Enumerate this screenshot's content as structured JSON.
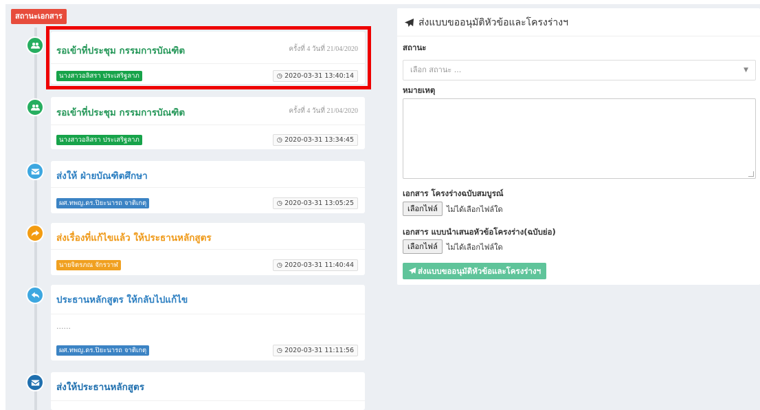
{
  "status_section": {
    "label": "สถานะเอกสาร"
  },
  "colors": {
    "green": "#27ae60",
    "sky": "#3da7e0",
    "orange": "#f39c12",
    "blue": "#1f6fae",
    "badge_green": "#17a34a",
    "badge_blue": "#3b83c4",
    "badge_orange": "#f0a020",
    "title_green": "#27985a",
    "title_blue": "#2d7fc1",
    "title_orange": "#ef9a1a"
  },
  "timeline": [
    {
      "icon": "users-icon",
      "title": "รอเข้าที่ประชุม กรรมการบัณฑิต",
      "meta": "ครั้งที่ 4 วันที่ 21/04/2020",
      "person": "นางสาวอลิสรา ประเสริฐลาภ",
      "timestamp": "2020-03-31 13:40:14"
    },
    {
      "icon": "users-icon",
      "title": "รอเข้าที่ประชุม กรรมการบัณฑิต",
      "meta": "ครั้งที่ 4 วันที่ 21/04/2020",
      "person": "นางสาวอลิสรา ประเสริฐลาภ",
      "timestamp": "2020-03-31 13:34:45"
    },
    {
      "icon": "envelope-icon",
      "title": "ส่งให้ ฝ่ายบัณฑิตศึกษา",
      "person": "ผศ.ทพญ.ดร.ปิยะนารถ จาติเกตุ",
      "timestamp": "2020-03-31 13:05:25"
    },
    {
      "icon": "share-icon",
      "title": "ส่งเรื่องที่แก้ไขแล้ว ให้ประธานหลักสูตร",
      "person": "นายจิตรภณ จักรวาฬ",
      "timestamp": "2020-03-31 11:40:44"
    },
    {
      "icon": "reply-icon",
      "title": "ประธานหลักสูตร ให้กลับไปแก้ไข",
      "note": "......",
      "person": "ผศ.ทพญ.ดร.ปิยะนารถ จาติเกตุ",
      "timestamp": "2020-03-31 11:11:56"
    },
    {
      "icon": "envelope-icon",
      "title": "ส่งให้ประธานหลักสูตร"
    }
  ],
  "form": {
    "title": "ส่งแบบขออนุมัติหัวข้อและโครงร่างฯ",
    "status_label": "สถานะ",
    "status_placeholder": "เลือก สถานะ ...",
    "remark_label": "หมายเหตุ",
    "full_doc_label": "เอกสาร โครงร่างฉบับสมบูรณ์",
    "short_doc_label": "เอกสาร แบบนำเสนอหัวข้อโครงร่าง(ฉบับย่อ)",
    "choose_file": "เลือกไฟล์",
    "no_file": "ไม่ได้เลือกไฟล์ใด",
    "submit_label": "ส่งแบบขออนุมัติหัวข้อและโครงร่างฯ"
  }
}
